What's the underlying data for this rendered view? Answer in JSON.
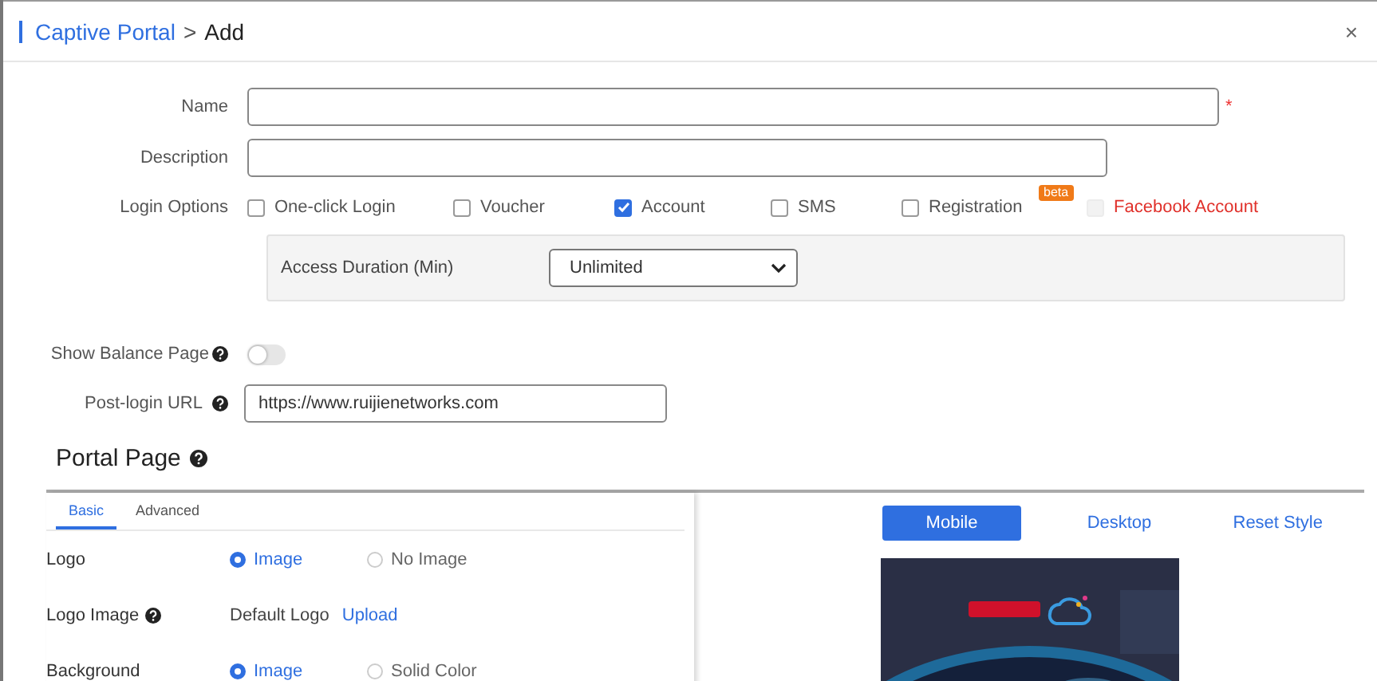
{
  "header": {
    "parent": "Captive Portal",
    "separator": ">",
    "current": "Add",
    "close": "×"
  },
  "form": {
    "name": {
      "label": "Name",
      "required": true,
      "required_mark": "*"
    },
    "description": {
      "label": "Description"
    },
    "login_options": {
      "label": "Login Options",
      "options": [
        {
          "label": "One-click Login",
          "checked": false,
          "disabled": false
        },
        {
          "label": "Voucher",
          "checked": false,
          "disabled": false
        },
        {
          "label": "Account",
          "checked": true,
          "disabled": false
        },
        {
          "label": "SMS",
          "checked": false,
          "disabled": false
        },
        {
          "label": "Registration",
          "checked": false,
          "disabled": false
        },
        {
          "label": "Facebook Account",
          "checked": false,
          "disabled": true,
          "badge": "beta"
        }
      ]
    },
    "access_duration": {
      "label": "Access Duration (Min)",
      "value": "Unlimited"
    },
    "show_balance": {
      "label": "Show Balance Page",
      "on": false
    },
    "post_login_url": {
      "label": "Post-login URL",
      "value": "https://www.ruijienetworks.com"
    }
  },
  "portal_page": {
    "title": "Portal Page",
    "tabs": [
      {
        "label": "Basic",
        "selected": true
      },
      {
        "label": "Advanced",
        "selected": false
      }
    ],
    "rows": [
      {
        "kind": "radio",
        "label": "Logo",
        "options": [
          {
            "label": "Image",
            "selected": true
          },
          {
            "label": "No Image",
            "selected": false
          }
        ]
      },
      {
        "kind": "upload",
        "label": "Logo Image",
        "help": true,
        "value": "Default Logo",
        "link": "Upload"
      },
      {
        "kind": "radio",
        "label": "Background",
        "options": [
          {
            "label": "Image",
            "selected": true
          },
          {
            "label": "Solid Color",
            "selected": false
          }
        ]
      }
    ],
    "views": [
      {
        "label": "Mobile",
        "selected": true
      },
      {
        "label": "Desktop",
        "selected": false
      }
    ],
    "reset": "Reset Style"
  }
}
